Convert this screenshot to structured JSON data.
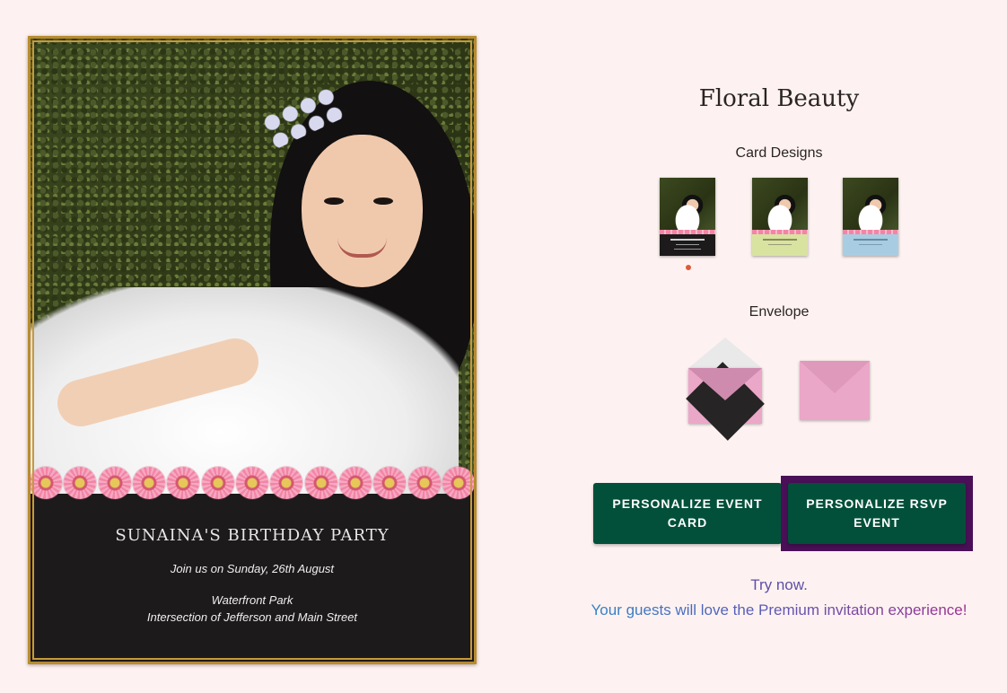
{
  "card": {
    "title": "SUNAINA'S BIRTHDAY PARTY",
    "line1": "Join us on Sunday, 26th August",
    "venue": "Waterfront Park",
    "address": "Intersection of Jefferson and Main Street"
  },
  "design": {
    "name": "Floral Beauty",
    "card_designs_label": "Card Designs",
    "envelope_label": "Envelope",
    "thumbnails": [
      {
        "name": "black",
        "color": "#1c1a1b",
        "selected": true
      },
      {
        "name": "green",
        "color": "#d9e3a0",
        "selected": false
      },
      {
        "name": "blue",
        "color": "#a8cde3",
        "selected": false
      }
    ],
    "selected_indicator_color": "#e0593b",
    "envelopes": [
      "envelope-open-black-liner",
      "envelope-closed-pink"
    ]
  },
  "actions": {
    "personalize_event_card": "PERSONALIZE EVENT CARD",
    "personalize_rsvp_event": "PERSONALIZE RSVP EVENT",
    "button_color": "#02503a",
    "highlight_color": "#4a0f57"
  },
  "promo": {
    "try_now": "Try now.",
    "tagline": "Your guests will love the Premium invitation experience!"
  },
  "colors": {
    "page_background": "#fdf2f1",
    "card_background": "#1c1a1b",
    "gold_frame": "#c79a3b",
    "envelope_pink": "#eba7c7"
  }
}
